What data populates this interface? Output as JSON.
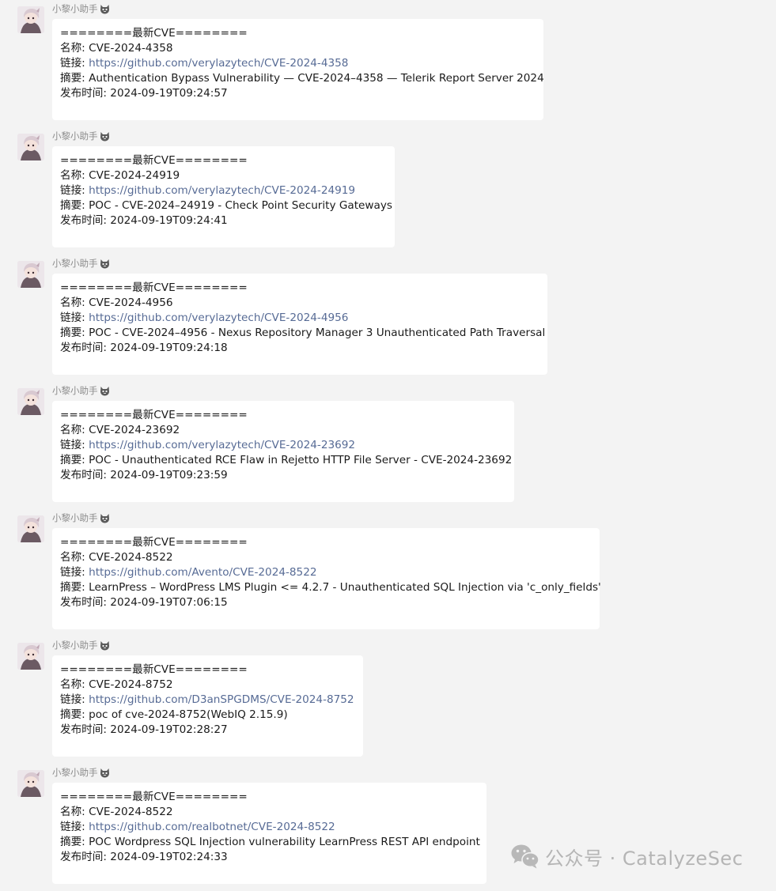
{
  "messages": [
    {
      "sender": "小黎小助手",
      "header": "========最新CVE========",
      "name_label": "名称:",
      "name": "CVE-2024-4358",
      "link_label": "链接:",
      "link": "https://github.com/verylazytech/CVE-2024-4358",
      "summary_label": "摘要:",
      "summary": "Authentication Bypass Vulnerability — CVE-2024–4358 — Telerik Report Server 2024",
      "time_label": "发布时间:",
      "time": "2024-09-19T09:24:57"
    },
    {
      "sender": "小黎小助手",
      "header": "========最新CVE========",
      "name_label": "名称:",
      "name": "CVE-2024-24919",
      "link_label": "链接:",
      "link": "https://github.com/verylazytech/CVE-2024-24919",
      "summary_label": "摘要:",
      "summary": "POC - CVE-2024–24919 - Check Point Security Gateways",
      "time_label": "发布时间:",
      "time": "2024-09-19T09:24:41"
    },
    {
      "sender": "小黎小助手",
      "header": "========最新CVE========",
      "name_label": "名称:",
      "name": "CVE-2024-4956",
      "link_label": "链接:",
      "link": "https://github.com/verylazytech/CVE-2024-4956",
      "summary_label": "摘要:",
      "summary": "POC - CVE-2024–4956 - Nexus Repository Manager 3 Unauthenticated Path Traversal",
      "time_label": "发布时间:",
      "time": "2024-09-19T09:24:18"
    },
    {
      "sender": "小黎小助手",
      "header": "========最新CVE========",
      "name_label": "名称:",
      "name": "CVE-2024-23692",
      "link_label": "链接:",
      "link": "https://github.com/verylazytech/CVE-2024-23692",
      "summary_label": "摘要:",
      "summary": "POC - Unauthenticated RCE Flaw in Rejetto HTTP File Server - CVE-2024-23692",
      "time_label": "发布时间:",
      "time": "2024-09-19T09:23:59"
    },
    {
      "sender": "小黎小助手",
      "header": "========最新CVE========",
      "name_label": "名称:",
      "name": "CVE-2024-8522",
      "link_label": "链接:",
      "link": "https://github.com/Avento/CVE-2024-8522",
      "summary_label": "摘要:",
      "summary": "LearnPress – WordPress LMS Plugin <= 4.2.7 - Unauthenticated SQL Injection via 'c_only_fields'",
      "time_label": "发布时间:",
      "time": "2024-09-19T07:06:15"
    },
    {
      "sender": "小黎小助手",
      "header": "========最新CVE========",
      "name_label": "名称:",
      "name": "CVE-2024-8752",
      "link_label": "链接:",
      "link": "https://github.com/D3anSPGDMS/CVE-2024-8752",
      "summary_label": "摘要:",
      "summary": "poc of cve-2024-8752(WebIQ 2.15.9)",
      "time_label": "发布时间:",
      "time": "2024-09-19T02:28:27"
    },
    {
      "sender": "小黎小助手",
      "header": "========最新CVE========",
      "name_label": "名称:",
      "name": "CVE-2024-8522",
      "link_label": "链接:",
      "link": "https://github.com/realbotnet/CVE-2024-8522",
      "summary_label": "摘要:",
      "summary": "POC Wordpress SQL Injection vulnerability  LearnPress REST API endpoint",
      "time_label": "发布时间:",
      "time": "2024-09-19T02:24:33"
    }
  ],
  "watermark": {
    "text": "公众号 · CatalyzeSec",
    "icon": "wechat-icon"
  },
  "colors": {
    "background": "#f3f3f3",
    "bubble": "#ffffff",
    "link": "#576b95",
    "sender": "#8c8c8c"
  }
}
